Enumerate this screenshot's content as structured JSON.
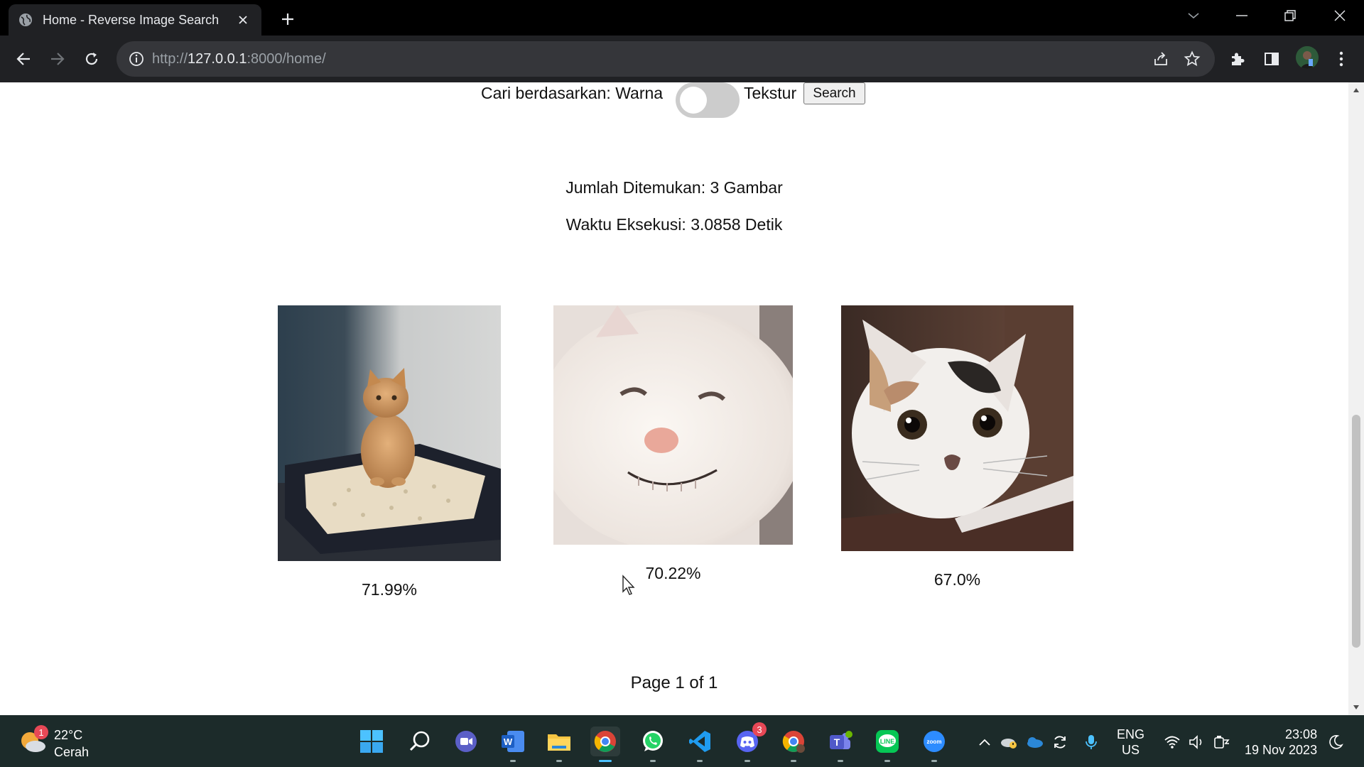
{
  "browser": {
    "tab_title": "Home - Reverse Image Search",
    "url_scheme": "http://",
    "url_host": "127.0.0.1",
    "url_rest": ":8000/home/"
  },
  "search": {
    "label_prefix": "Cari berdasarkan: Warna",
    "label_suffix": "Tekstur",
    "toggle_on": false,
    "button_label": "Search"
  },
  "stats": {
    "found": "Jumlah Ditemukan: 3 Gambar",
    "time": "Waktu Eksekusi: 3.0858 Detik"
  },
  "results": [
    {
      "image": "kitten-in-litter-box",
      "similarity": "71.99%"
    },
    {
      "image": "smiling-white-cat",
      "similarity": "70.22%"
    },
    {
      "image": "calico-cat-closeup",
      "similarity": "67.0%"
    }
  ],
  "pagination": "Page 1 of 1",
  "taskbar": {
    "weather_temp": "22°C",
    "weather_condition": "Cerah",
    "weather_badge": "1",
    "discord_badge": "3",
    "lang_line1": "ENG",
    "lang_line2": "US",
    "time": "23:08",
    "date": "19 Nov 2023",
    "apps": [
      "start",
      "search",
      "meet",
      "word",
      "file-explorer",
      "chrome",
      "whatsapp",
      "vscode",
      "discord",
      "chrome-profile",
      "teams",
      "line",
      "zoom"
    ]
  },
  "colors": {
    "tabstrip": "#000000",
    "toolbar": "#202124",
    "taskbar": "#1c2b2a",
    "toggle_off": "#cccccc"
  }
}
